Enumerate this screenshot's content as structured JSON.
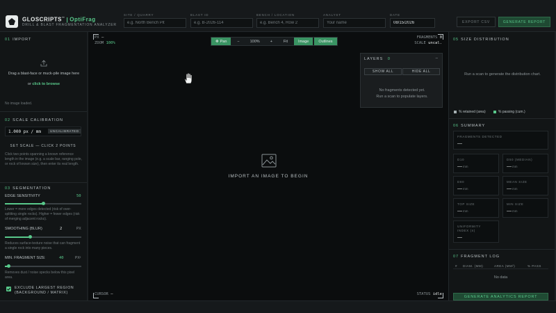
{
  "header": {
    "brand": "GLOSCRIPTS",
    "trademark": "™",
    "app_name": "OptiFrag",
    "tagline": "DRILL & BLAST FRAGMENTATION ANALYZER",
    "fields": [
      {
        "label": "SITE / QUARRY",
        "placeholder": "e.g. North Bench Pit",
        "value": ""
      },
      {
        "label": "BLAST ID",
        "placeholder": "e.g. B-2026-114",
        "value": ""
      },
      {
        "label": "BENCH / LOCATION",
        "placeholder": "e.g. Bench 4, Row 2",
        "value": ""
      },
      {
        "label": "ANALYST",
        "placeholder": "Your name",
        "value": ""
      },
      {
        "label": "DATE",
        "placeholder": "",
        "value": "08/15/2026"
      }
    ],
    "export_csv": "EXPORT CSV",
    "generate_report": "GENERATE REPORT"
  },
  "import": {
    "num": "01",
    "title": "IMPORT",
    "drop_text": "Drag a blast-face or muck-pile image here",
    "or_text": "or",
    "browse": "click to browse",
    "status": "No image loaded."
  },
  "scale": {
    "num": "02",
    "title": "SCALE CALIBRATION",
    "value": "1.000 px / mm",
    "badge": "UNCALIBRATED",
    "set_scale": "SET SCALE — CLICK 2 POINTS",
    "help": "Click two points spanning a known reference length in the image (e.g. a scale bar, ranging pole, or rock of known size), then enter its real length."
  },
  "segmentation": {
    "num": "03",
    "title": "SEGMENTATION",
    "edge_label": "EDGE SENSITIVITY",
    "edge_value": "50",
    "edge_fraction": 0.5,
    "edge_help": "Lower = more edges detected (risk of over-splitting single rocks). Higher = fewer edges (risk of merging adjacent rocks).",
    "smooth_label": "SMOOTHING (BLUR)",
    "smooth_value": "2",
    "smooth_unit": "PX",
    "smooth_fraction": 0.33,
    "smooth_help": "Reduces surface-texture noise that can fragment a single rock into many pieces.",
    "minfrag_label": "MIN. FRAGMENT SIZE",
    "minfrag_value": "40",
    "minfrag_unit": "PX²",
    "minfrag_fraction": 0.05,
    "minfrag_help": "Removes dust / noise specks below this pixel area.",
    "exclude_label": "EXCLUDE LARGEST REGION (BACKGROUND / MATRIX)"
  },
  "canvas": {
    "px_label": "PX",
    "px_value": "—",
    "zoom_label": "ZOOM",
    "zoom_value": "100%",
    "fragments_label": "FRAGMENTS",
    "fragments_value": "0",
    "scale_label": "SCALE",
    "scale_value": "uncal.",
    "pan": "Pan",
    "minus": "−",
    "zoom": "100%",
    "plus": "+",
    "fit": "Fit",
    "image": "Image",
    "outlines": "Outlines",
    "empty": "IMPORT AN IMAGE TO BEGIN",
    "cursor_label": "CURSOR",
    "cursor_value": "—",
    "status_label": "STATUS",
    "status_value": "idle"
  },
  "layers": {
    "title": "LAYERS",
    "count": "0",
    "close": "–",
    "show_all": "SHOW ALL",
    "hide_all": "HIDE ALL",
    "empty1": "No fragments detected yet.",
    "empty2": "Run a scan to populate layers."
  },
  "distribution": {
    "num": "05",
    "title": "SIZE DISTRIBUTION",
    "empty": "Run a scan to generate the distribution chart.",
    "legend_retained": "% retained (area)",
    "legend_passing": "% passing (cum.)"
  },
  "summary": {
    "num": "06",
    "title": "SUMMARY",
    "fragments_label": "FRAGMENTS DETECTED",
    "fragments_value": "—",
    "stats": [
      {
        "label": "D10",
        "value": "—",
        "unit": "mm"
      },
      {
        "label": "D50 (MEDIAN)",
        "value": "—",
        "unit": "mm"
      },
      {
        "label": "D80",
        "value": "—",
        "unit": "mm"
      },
      {
        "label": "MEAN SIZE",
        "value": "—",
        "unit": "mm"
      },
      {
        "label": "TOP SIZE",
        "value": "—",
        "unit": "mm"
      },
      {
        "label": "MIN SIZE",
        "value": "—",
        "unit": "mm"
      }
    ],
    "uniformity_label": "UNIFORMITY INDEX (n)",
    "uniformity_value": "—"
  },
  "log": {
    "num": "07",
    "title": "FRAGMENT LOG",
    "columns": [
      "#",
      "DIAM. (MM)",
      "AREA (MM²)",
      "% PASS"
    ],
    "empty": "No data",
    "generate": "GENERATE ANALYTICS REPORT"
  }
}
